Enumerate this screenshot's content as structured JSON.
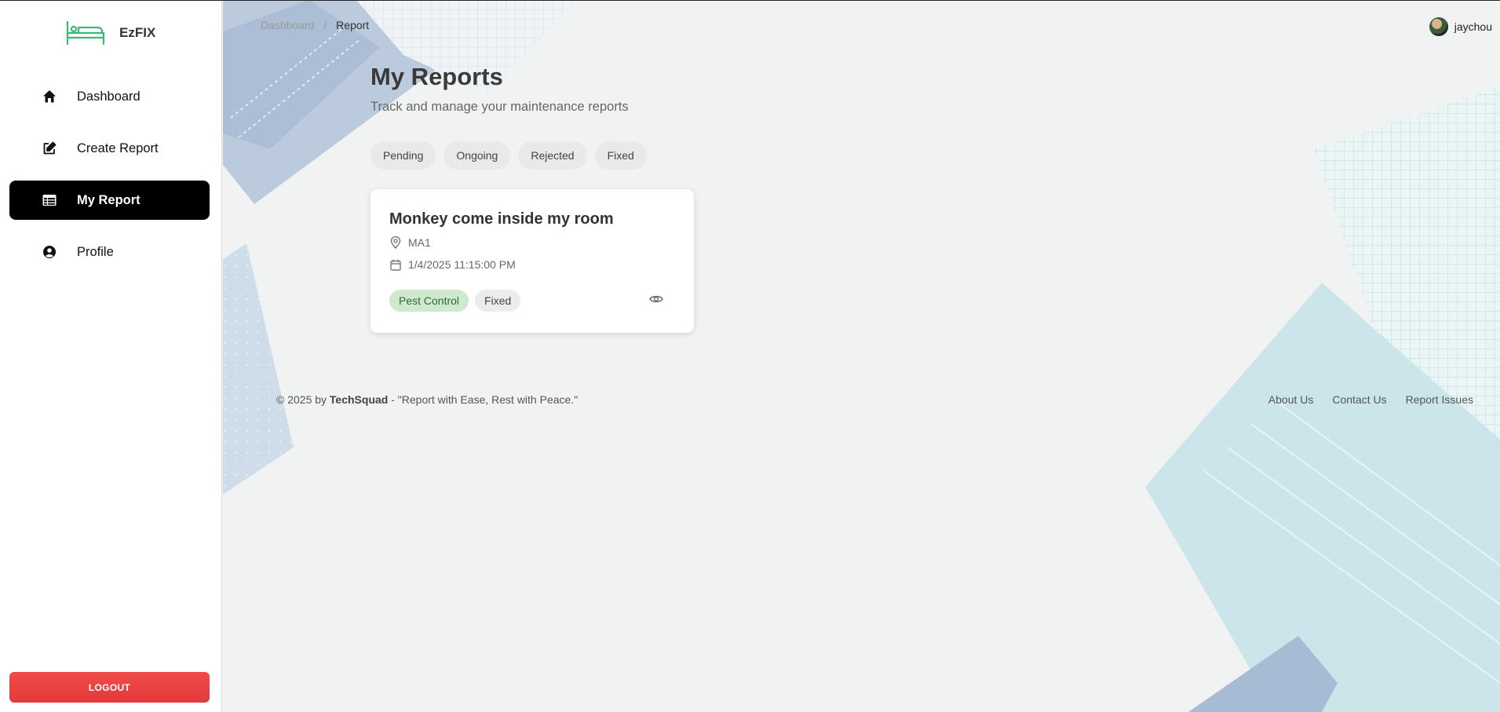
{
  "app": {
    "name": "EzFIX",
    "brand_color": "#3cb878"
  },
  "sidebar": {
    "items": [
      {
        "label": "Dashboard",
        "icon": "home-icon"
      },
      {
        "label": "Create Report",
        "icon": "edit-icon"
      },
      {
        "label": "My Report",
        "icon": "table-icon",
        "active": true
      },
      {
        "label": "Profile",
        "icon": "user-circle-icon"
      }
    ],
    "logout_label": "LOGOUT",
    "logout_color": "#e94141"
  },
  "header": {
    "breadcrumb": [
      "Dashboard",
      "Report"
    ],
    "separator": "/",
    "username": "jaychou"
  },
  "main": {
    "title": "My Reports",
    "subtitle": "Track and manage your maintenance reports",
    "filters": [
      "Pending",
      "Ongoing",
      "Rejected",
      "Fixed"
    ],
    "reports": [
      {
        "title": "Monkey come inside my room",
        "location": "MA1",
        "datetime": "1/4/2025 11:15:00 PM",
        "category": "Pest Control",
        "status": "Fixed"
      }
    ]
  },
  "footer": {
    "copyright": "© 2025 by",
    "company": "TechSquad",
    "tagline": "- \"Report with Ease, Rest with Peace.\"",
    "links": [
      "About Us",
      "Contact Us",
      "Report Issues"
    ]
  }
}
